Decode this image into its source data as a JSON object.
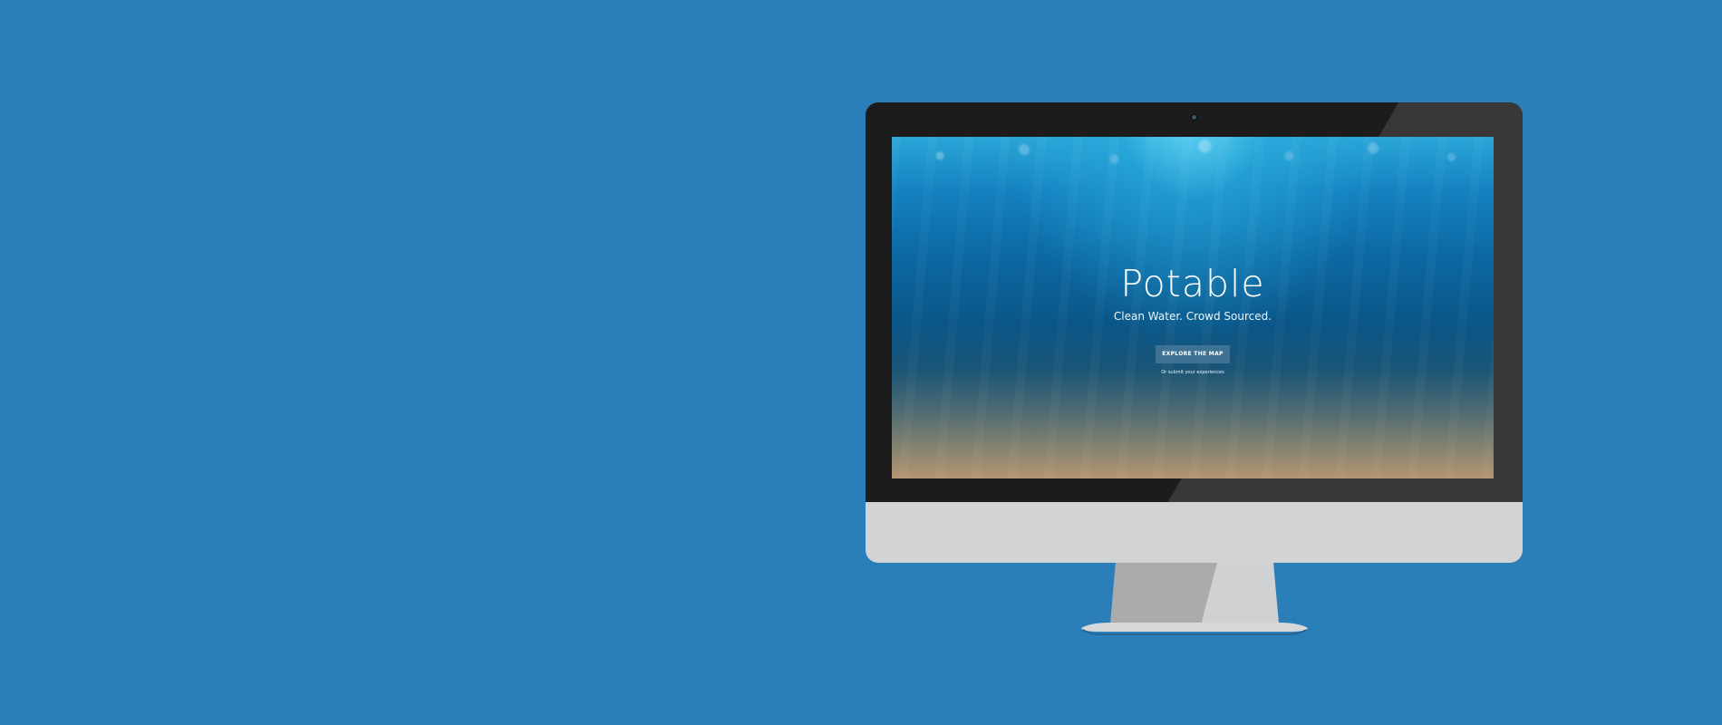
{
  "page": {
    "background_color": "#2b7fb8"
  },
  "site": {
    "title": "Potable",
    "subtitle": "Clean Water. Crowd Sourced.",
    "cta_label": "EXPLORE THE MAP",
    "secondary_link": "Or submit your experiences"
  },
  "colors": {
    "bezel": "#1c1c1c",
    "chin": "#d1d3d5",
    "stand": "#b7b9bb",
    "button": "#46789a"
  }
}
